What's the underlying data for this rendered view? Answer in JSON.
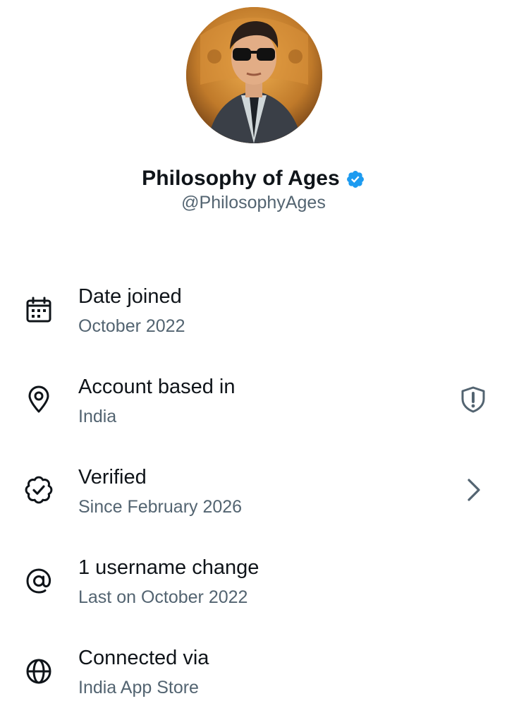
{
  "profile": {
    "display_name": "Philosophy of Ages",
    "handle": "@PhilosophyAges",
    "avatar_icon": "profile-avatar",
    "verified_badge_icon": "verified-check-icon",
    "verified_badge_color": "#1d9bf0"
  },
  "info_rows": [
    {
      "icon": "calendar-icon",
      "title": "Date joined",
      "subtitle": "October 2022"
    },
    {
      "icon": "location-pin-icon",
      "title": "Account based in",
      "subtitle": "India",
      "trailing_icon": "shield-alert-icon"
    },
    {
      "icon": "verified-badge-outline-icon",
      "title": "Verified",
      "subtitle": "Since February 2026",
      "trailing_icon": "chevron-right-icon"
    },
    {
      "icon": "at-sign-icon",
      "title": "1 username change",
      "subtitle": "Last on October 2022"
    },
    {
      "icon": "globe-icon",
      "title": "Connected via",
      "subtitle": "India App Store"
    }
  ],
  "colors": {
    "primary_text": "#0f1419",
    "secondary_text": "#536471",
    "accent": "#1d9bf0"
  }
}
